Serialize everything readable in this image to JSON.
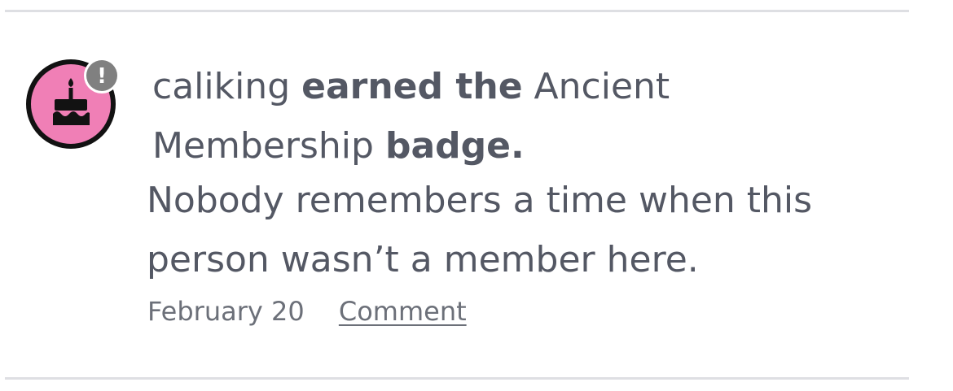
{
  "activity": {
    "username": "caliking",
    "action_text": "earned the",
    "badge_name": "Ancient Membership",
    "badge_word": "badge.",
    "description_line1": "Nobody remembers a time when this",
    "description_line2": "person wasn’t a member here.",
    "date": "February 20",
    "comment_label": "Comment"
  },
  "badge_icon": {
    "name": "birthday-cake-icon",
    "alert_symbol": "!",
    "colors": {
      "fill": "#f07fb6",
      "ring": "#121212",
      "alert_bg": "#808080",
      "alert_fg": "#ffffff"
    }
  }
}
